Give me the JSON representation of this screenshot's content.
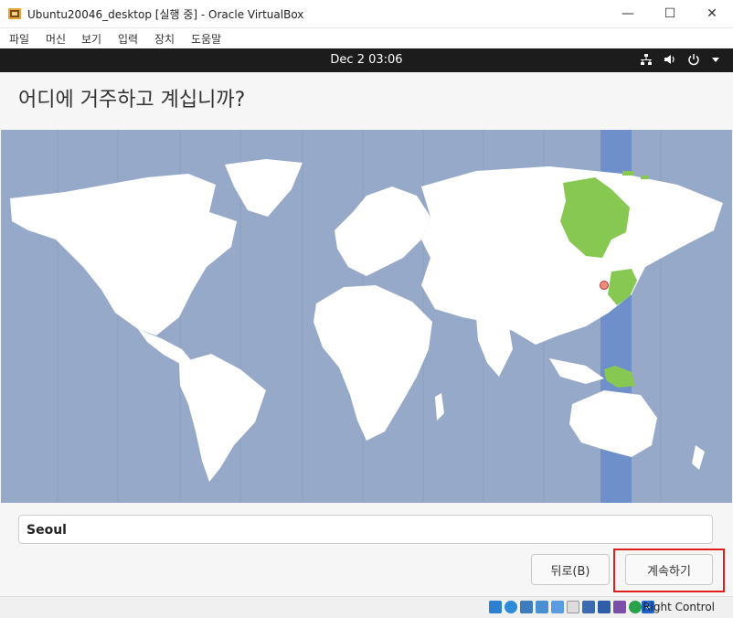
{
  "window": {
    "title": "Ubuntu20046_desktop [실행 중] - Oracle VirtualBox",
    "minimize_glyph": "—",
    "maximize_glyph": "☐",
    "close_glyph": "✕"
  },
  "menu": [
    "파일",
    "머신",
    "보기",
    "입력",
    "장치",
    "도움말"
  ],
  "gnome": {
    "clock": "Dec 2  03:06"
  },
  "installer": {
    "heading": "어디에 거주하고 계십니까?",
    "timezone_value": "Seoul",
    "back_label": "뒤로(B)",
    "continue_label": "계속하기"
  },
  "statusbar": {
    "host_key": "Right Control"
  },
  "colors": {
    "ocean": "#97a9c9",
    "land": "#ffffff",
    "selected_zone": "#6e8fc9",
    "selected_region": "#86c851",
    "highlight": "#e0201a"
  },
  "icons": [
    "network-icon",
    "volume-icon",
    "power-icon",
    "chevron-down-icon"
  ]
}
